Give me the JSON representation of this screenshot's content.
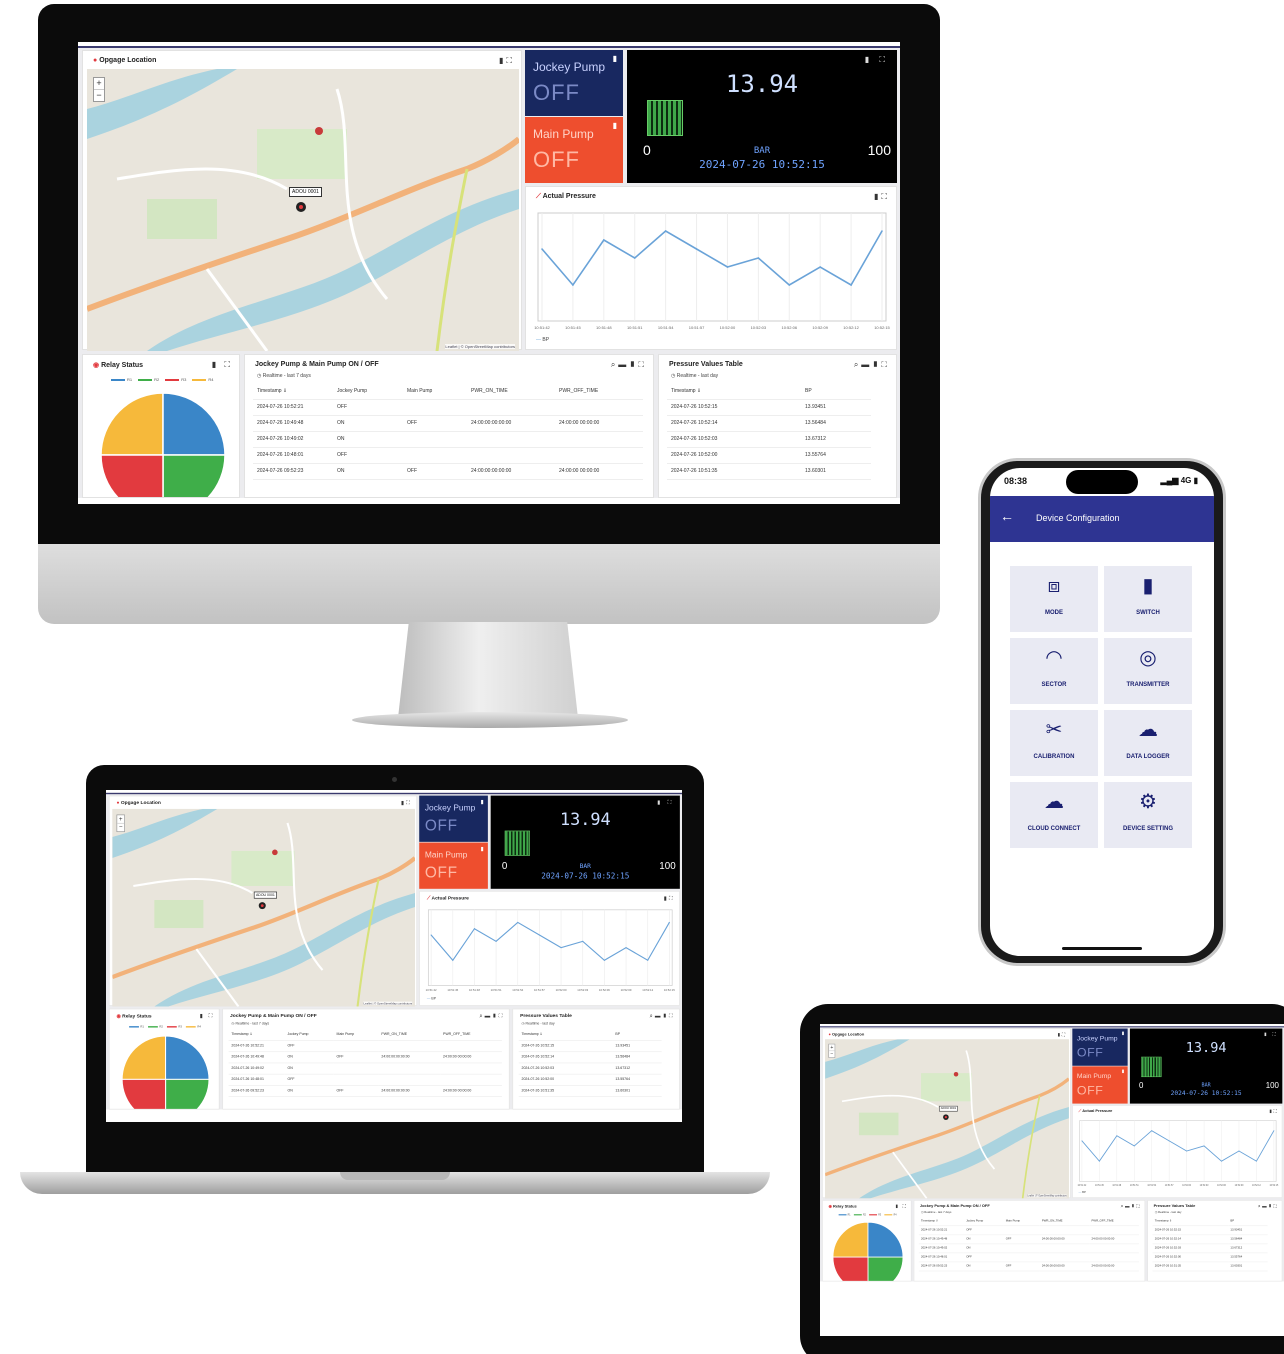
{
  "dashboard": {
    "map_panel": {
      "title": "Opgage Location",
      "zoom_in": "+",
      "zoom_out": "−",
      "marker_label": "ADOU 0001",
      "attribution": "Leaflet | © OpenStreetMap contributors"
    },
    "jockey_pump": {
      "label": "Jockey Pump",
      "state": "OFF",
      "color": "#182860"
    },
    "main_pump": {
      "label": "Main Pump",
      "state": "OFF",
      "color": "#ee4e2e"
    },
    "gauge": {
      "value": "13.94",
      "min": "0",
      "max": "100",
      "unit": "BAR",
      "timestamp": "2024-07-26 10:52:15",
      "fill_fraction": 0.14
    },
    "pressure_chart_panel": {
      "title": "Actual Pressure"
    },
    "relay_panel": {
      "title": "Relay Status",
      "legend": [
        "R1",
        "R2",
        "R3",
        "R4"
      ],
      "colors": [
        "#3a86c8",
        "#3fae49",
        "#e23a3f",
        "#f6b93b"
      ]
    },
    "pump_table": {
      "title": "Jockey Pump & Main Pump ON / OFF",
      "subtitle": "Realtime - last 7 days",
      "headers": [
        "Timestamp ⇓",
        "Jockey Pump",
        "Main Pump",
        "PWR_ON_TIME",
        "PWR_OFF_TIME"
      ],
      "rows": [
        [
          "2024-07-26 10:52:21",
          "OFF",
          "",
          "",
          ""
        ],
        [
          "2024-07-26 10:49:48",
          "ON",
          "OFF",
          "24:00:00:00:00:00",
          "24:00:00 00:00:00"
        ],
        [
          "2024-07-26 10:49:02",
          "ON",
          "",
          "",
          ""
        ],
        [
          "2024-07-26 10:48:01",
          "OFF",
          "",
          "",
          ""
        ],
        [
          "2024-07-26 09:52:23",
          "ON",
          "OFF",
          "24:00:00:00:00:00",
          "24:00:00 00:00:00"
        ]
      ]
    },
    "pressure_table": {
      "title": "Pressure Values Table",
      "subtitle": "Realtime - last day",
      "headers": [
        "Timestamp ⇓",
        "BP"
      ],
      "rows": [
        [
          "2024-07-26 10:52:15",
          "13.93451"
        ],
        [
          "2024-07-26 10:52:14",
          "13.56484"
        ],
        [
          "2024-07-26 10:52:03",
          "13.67312"
        ],
        [
          "2024-07-26 10:52:00",
          "13.55764"
        ],
        [
          "2024-07-26 10:51:35",
          "13.60301"
        ]
      ]
    }
  },
  "chart_data": {
    "type": "line",
    "title": "Actual Pressure",
    "series": [
      {
        "name": "BP",
        "color": "#6aa3d8",
        "values": [
          13.7,
          13.3,
          13.8,
          13.6,
          13.9,
          13.7,
          13.5,
          13.6,
          13.3,
          13.5,
          13.3,
          13.9
        ]
      }
    ],
    "x": [
      "10:51:42",
      "10:51:45",
      "10:51:48",
      "10:51:51",
      "10:51:54",
      "10:51:57",
      "10:52:00",
      "10:52:03",
      "10:52:06",
      "10:52:09",
      "10:52:12",
      "10:52:15"
    ],
    "ylim": [
      12.9,
      14.1
    ],
    "grid": true,
    "legend": "bottom-left"
  },
  "phone": {
    "time": "08:38",
    "signal": "4G",
    "title": "Device Configuration",
    "tiles": [
      {
        "label": "MODE",
        "icon": "crop-icon"
      },
      {
        "label": "SWITCH",
        "icon": "switch-icon"
      },
      {
        "label": "SECTOR",
        "icon": "gauge-icon"
      },
      {
        "label": "TRANSMITTER",
        "icon": "antenna-icon"
      },
      {
        "label": "CALIBRATION",
        "icon": "tools-icon"
      },
      {
        "label": "DATA LOGGER",
        "icon": "database-cloud-icon"
      },
      {
        "label": "CLOUD CONNECT",
        "icon": "cloud-upload-icon"
      },
      {
        "label": "DEVICE SETTING",
        "icon": "gear-icon"
      }
    ]
  }
}
